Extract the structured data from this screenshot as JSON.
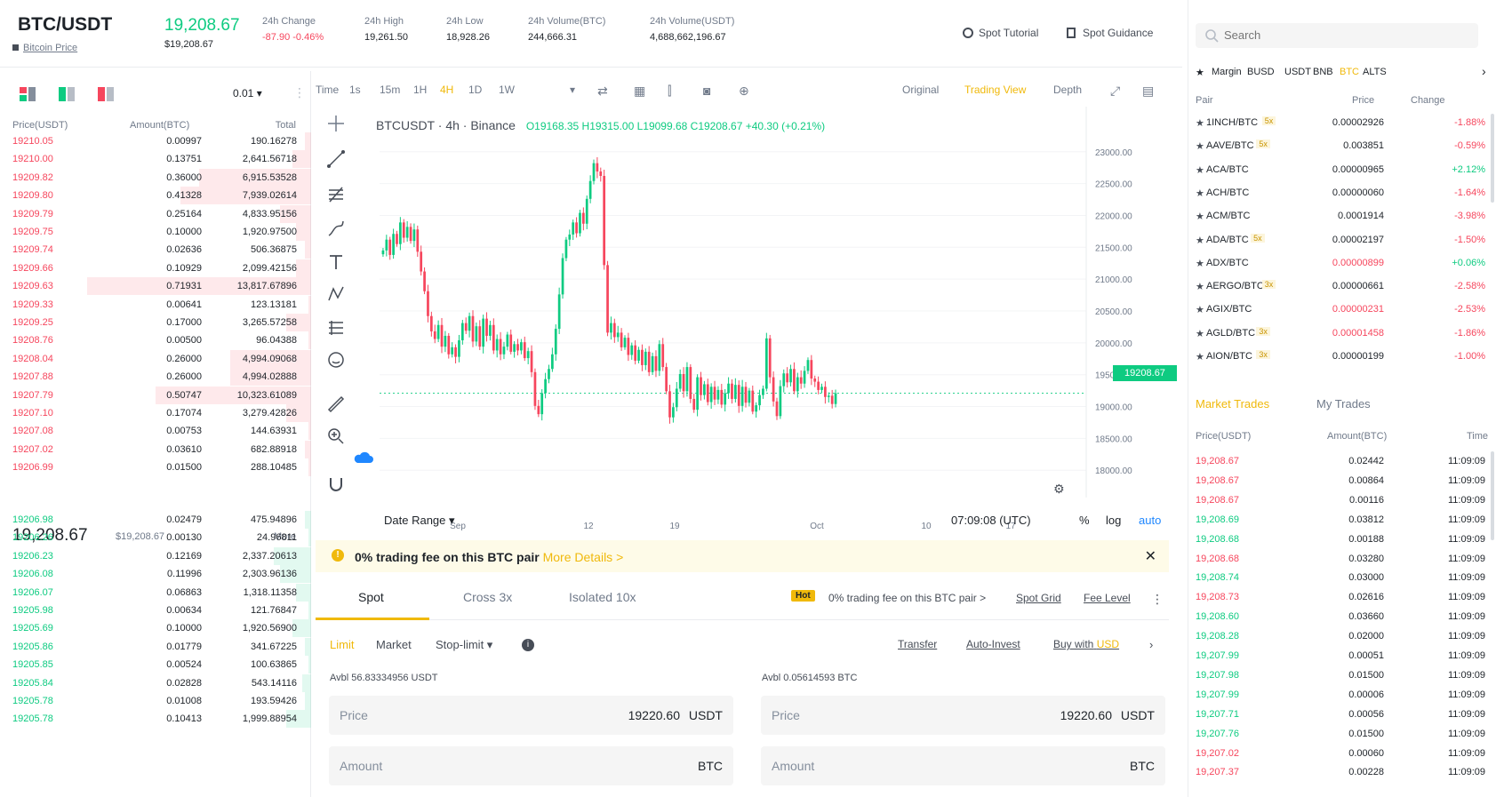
{
  "header": {
    "pair": "BTC/USDT",
    "bitcoin_price_link": "Bitcoin Price",
    "last_price": "19,208.67",
    "last_price_usd": "$19,208.67",
    "stats": [
      {
        "label": "24h Change",
        "value": "-87.90 -0.46%",
        "color": "red"
      },
      {
        "label": "24h High",
        "value": "19,261.50",
        "color": ""
      },
      {
        "label": "24h Low",
        "value": "18,928.26",
        "color": ""
      },
      {
        "label": "24h Volume(BTC)",
        "value": "244,666.31",
        "color": ""
      },
      {
        "label": "24h Volume(USDT)",
        "value": "4,688,662,196.67",
        "color": ""
      }
    ],
    "spot_tutorial": "Spot Tutorial",
    "spot_guidance": "Spot Guidance"
  },
  "orderbook": {
    "precision": "0.01",
    "col_price": "Price(USDT)",
    "col_amount": "Amount(BTC)",
    "col_total": "Total",
    "asks": [
      {
        "price": "19210.05",
        "amount": "0.00997",
        "total": "190.16278",
        "depth": 0.02
      },
      {
        "price": "19210.00",
        "amount": "0.13751",
        "total": "2,641.56718",
        "depth": 0.06
      },
      {
        "price": "19209.82",
        "amount": "0.36000",
        "total": "6,915.53528",
        "depth": 0.36
      },
      {
        "price": "19209.80",
        "amount": "0.41328",
        "total": "7,939.02614",
        "depth": 0.42
      },
      {
        "price": "19209.79",
        "amount": "0.25164",
        "total": "4,833.95156",
        "depth": 0.1
      },
      {
        "price": "19209.75",
        "amount": "0.10000",
        "total": "1,920.97500",
        "depth": 0.05
      },
      {
        "price": "19209.74",
        "amount": "0.02636",
        "total": "506.36875",
        "depth": 0.02
      },
      {
        "price": "19209.66",
        "amount": "0.10929",
        "total": "2,099.42156",
        "depth": 0.05
      },
      {
        "price": "19209.63",
        "amount": "0.71931",
        "total": "13,817.67896",
        "depth": 0.72
      },
      {
        "price": "19209.33",
        "amount": "0.00641",
        "total": "123.13181",
        "depth": 0.01
      },
      {
        "price": "19209.25",
        "amount": "0.17000",
        "total": "3,265.57258",
        "depth": 0.08
      },
      {
        "price": "19208.76",
        "amount": "0.00500",
        "total": "96.04388",
        "depth": 0.01
      },
      {
        "price": "19208.04",
        "amount": "0.26000",
        "total": "4,994.09068",
        "depth": 0.26
      },
      {
        "price": "19207.88",
        "amount": "0.26000",
        "total": "4,994.02888",
        "depth": 0.26
      },
      {
        "price": "19207.79",
        "amount": "0.50747",
        "total": "10,323.61089",
        "depth": 0.5
      },
      {
        "price": "19207.10",
        "amount": "0.17074",
        "total": "3,279.42826",
        "depth": 0.08
      },
      {
        "price": "19207.08",
        "amount": "0.00753",
        "total": "144.63931",
        "depth": 0.01
      },
      {
        "price": "19207.02",
        "amount": "0.03610",
        "total": "682.88918",
        "depth": 0.02
      },
      {
        "price": "19206.99",
        "amount": "0.01500",
        "total": "288.10485",
        "depth": 0.01
      }
    ],
    "mid_price": "19,208.67",
    "mid_price_usd": "$19,208.67",
    "more": "More",
    "bids": [
      {
        "price": "19206.98",
        "amount": "0.02479",
        "total": "475.94896",
        "depth": 0.02
      },
      {
        "price": "19206.26",
        "amount": "0.00130",
        "total": "24.96811",
        "depth": 0.01
      },
      {
        "price": "19206.23",
        "amount": "0.12169",
        "total": "2,337.20613",
        "depth": 0.12
      },
      {
        "price": "19206.08",
        "amount": "0.11996",
        "total": "2,303.96136",
        "depth": 0.1
      },
      {
        "price": "19206.07",
        "amount": "0.06863",
        "total": "1,318.11358",
        "depth": 0.05
      },
      {
        "price": "19205.98",
        "amount": "0.00634",
        "total": "121.76847",
        "depth": 0.01
      },
      {
        "price": "19205.69",
        "amount": "0.10000",
        "total": "1,920.56900",
        "depth": 0.06
      },
      {
        "price": "19205.86",
        "amount": "0.01779",
        "total": "341.67225",
        "depth": 0.02
      },
      {
        "price": "19205.85",
        "amount": "0.00524",
        "total": "100.63865",
        "depth": 0.01
      },
      {
        "price": "19205.84",
        "amount": "0.02828",
        "total": "543.14116",
        "depth": 0.03
      },
      {
        "price": "19205.78",
        "amount": "0.01008",
        "total": "193.59426",
        "depth": 0.02
      },
      {
        "price": "19205.78",
        "amount": "0.10413",
        "total": "1,999.88954",
        "depth": 0.08
      }
    ]
  },
  "chart_toolbar": {
    "intervals": [
      "Time",
      "1s",
      "15m",
      "1H",
      "4H",
      "1D",
      "1W"
    ],
    "active_interval": "4H",
    "views": [
      "Original",
      "Trading View",
      "Depth"
    ],
    "active_view": "Trading View"
  },
  "chart_data": {
    "type": "candlestick",
    "symbol": "BTCUSDT",
    "interval": "4h",
    "exchange": "Binance",
    "ohlc_label": "O19168.35 H19315.00 L19099.68 C19208.67 +40.30 (+0.21%)",
    "y_ticks": [
      "23000.00",
      "22500.00",
      "22000.00",
      "21500.00",
      "21000.00",
      "20500.00",
      "20000.00",
      "19500.00",
      "19000.00",
      "18500.00",
      "18000.00"
    ],
    "x_ticks": [
      "Sep",
      "12",
      "19",
      "Oct",
      "10",
      "17"
    ],
    "ylim": [
      17850,
      23150
    ],
    "last_price": "19208.67",
    "date_range": "Date Range",
    "time": "07:09:08 (UTC)",
    "pct": "%",
    "log": "log",
    "auto": "auto",
    "closes": [
      21450,
      21620,
      21380,
      21710,
      21550,
      21890,
      21650,
      21820,
      21600,
      21780,
      21430,
      21120,
      20810,
      20420,
      20180,
      20060,
      20280,
      19940,
      20110,
      19820,
      19930,
      19780,
      20040,
      20310,
      20190,
      20420,
      20020,
      20260,
      19940,
      20380,
      20110,
      20280,
      19880,
      20060,
      19820,
      19940,
      20130,
      19860,
      19980,
      19880,
      20010,
      19760,
      19870,
      19540,
      19010,
      18880,
      19210,
      19430,
      19590,
      19820,
      20220,
      20760,
      21330,
      21620,
      21700,
      21890,
      21720,
      22040,
      21870,
      22260,
      22540,
      22820,
      22690,
      22620,
      21220,
      20160,
      20310,
      20090,
      20160,
      19930,
      20080,
      19810,
      19960,
      19720,
      19890,
      19650,
      19860,
      19540,
      19790,
      19560,
      19980,
      19620,
      19240,
      18830,
      18990,
      19280,
      19510,
      19240,
      19620,
      19120,
      18950,
      19460,
      19180,
      19350,
      19070,
      19310,
      19110,
      19260,
      19030,
      19210,
      19360,
      19120,
      19340,
      19010,
      19310,
      19060,
      19250,
      18920,
      19020,
      19180,
      19280,
      20070,
      19460,
      19080,
      18850,
      19320,
      19520,
      19380,
      19590,
      19240,
      19460,
      19360,
      19560,
      19730,
      19440,
      19390,
      19260,
      19310,
      19150,
      19170,
      19040,
      19208.67
    ]
  },
  "fee_banner": {
    "text": "0% trading fee on this BTC pair",
    "more": "More Details >"
  },
  "trade_panel": {
    "tabs": [
      "Spot",
      "Cross 3x",
      "Isolated 10x"
    ],
    "active_tab": "Spot",
    "hot_badge": "Hot",
    "hot_text": "0% trading fee on this BTC pair >",
    "spot_grid": "Spot Grid",
    "fee_level": "Fee Level",
    "order_types": [
      "Limit",
      "Market",
      "Stop-limit"
    ],
    "active_order_type": "Limit",
    "transfer": "Transfer",
    "auto_invest": "Auto-Invest",
    "buy_with": "Buy with",
    "buy_with_currency": "USD",
    "buy_avbl": "Avbl  56.83334956 USDT",
    "sell_avbl": "Avbl  0.05614593 BTC",
    "price_label": "Price",
    "price_value": "19220.60",
    "price_unit": "USDT",
    "amount_label": "Amount",
    "amount_unit": "BTC"
  },
  "markets": {
    "search_placeholder": "Search",
    "tabs": [
      "Margin",
      "BUSD",
      "USDT",
      "BNB",
      "BTC",
      "ALTS"
    ],
    "active_tab": "BTC",
    "col_pair": "Pair",
    "col_price": "Price",
    "col_change": "Change",
    "rows": [
      {
        "pair": "1INCH/BTC",
        "lev": "5x",
        "price": "0.00002926",
        "change": "-1.88%",
        "color": "red"
      },
      {
        "pair": "AAVE/BTC",
        "lev": "5x",
        "price": "0.003851",
        "change": "-0.59%",
        "color": "red"
      },
      {
        "pair": "ACA/BTC",
        "lev": "",
        "price": "0.00000965",
        "change": "+2.12%",
        "color": "green"
      },
      {
        "pair": "ACH/BTC",
        "lev": "",
        "price": "0.00000060",
        "change": "-1.64%",
        "color": "red"
      },
      {
        "pair": "ACM/BTC",
        "lev": "",
        "price": "0.0001914",
        "change": "-3.98%",
        "color": "red"
      },
      {
        "pair": "ADA/BTC",
        "lev": "5x",
        "price": "0.00002197",
        "change": "-1.50%",
        "color": "red"
      },
      {
        "pair": "ADX/BTC",
        "lev": "",
        "price": "0.00000899",
        "change": "+0.06%",
        "color": "green"
      },
      {
        "pair": "AERGO/BTC",
        "lev": "3x",
        "price": "0.00000661",
        "change": "-2.58%",
        "color": "red"
      },
      {
        "pair": "AGIX/BTC",
        "lev": "",
        "price": "0.00000231",
        "change": "-2.53%",
        "color": "red"
      },
      {
        "pair": "AGLD/BTC",
        "lev": "3x",
        "price": "0.00001458",
        "change": "-1.86%",
        "color": "red"
      },
      {
        "pair": "AION/BTC",
        "lev": "3x",
        "price": "0.00000199",
        "change": "-1.00%",
        "color": "red"
      }
    ]
  },
  "trades": {
    "tabs": [
      "Market Trades",
      "My Trades"
    ],
    "active_tab": "Market Trades",
    "col_price": "Price(USDT)",
    "col_amount": "Amount(BTC)",
    "col_time": "Time",
    "rows": [
      {
        "price": "19,208.67",
        "amount": "0.02442",
        "time": "11:09:09",
        "color": "red"
      },
      {
        "price": "19,208.67",
        "amount": "0.00864",
        "time": "11:09:09",
        "color": "red"
      },
      {
        "price": "19,208.67",
        "amount": "0.00116",
        "time": "11:09:09",
        "color": "red"
      },
      {
        "price": "19,208.69",
        "amount": "0.03812",
        "time": "11:09:09",
        "color": "green"
      },
      {
        "price": "19,208.68",
        "amount": "0.00188",
        "time": "11:09:09",
        "color": "green"
      },
      {
        "price": "19,208.68",
        "amount": "0.03280",
        "time": "11:09:09",
        "color": "red"
      },
      {
        "price": "19,208.74",
        "amount": "0.03000",
        "time": "11:09:09",
        "color": "green"
      },
      {
        "price": "19,208.73",
        "amount": "0.02616",
        "time": "11:09:09",
        "color": "red"
      },
      {
        "price": "19,208.60",
        "amount": "0.03660",
        "time": "11:09:09",
        "color": "green"
      },
      {
        "price": "19,208.28",
        "amount": "0.02000",
        "time": "11:09:09",
        "color": "green"
      },
      {
        "price": "19,207.99",
        "amount": "0.00051",
        "time": "11:09:09",
        "color": "green"
      },
      {
        "price": "19,207.98",
        "amount": "0.01500",
        "time": "11:09:09",
        "color": "green"
      },
      {
        "price": "19,207.99",
        "amount": "0.00006",
        "time": "11:09:09",
        "color": "green"
      },
      {
        "price": "19,207.71",
        "amount": "0.00056",
        "time": "11:09:09",
        "color": "green"
      },
      {
        "price": "19,207.76",
        "amount": "0.01500",
        "time": "11:09:09",
        "color": "green"
      },
      {
        "price": "19,207.02",
        "amount": "0.00060",
        "time": "11:09:09",
        "color": "red"
      },
      {
        "price": "19,207.37",
        "amount": "0.00228",
        "time": "11:09:09",
        "color": "red"
      }
    ]
  }
}
